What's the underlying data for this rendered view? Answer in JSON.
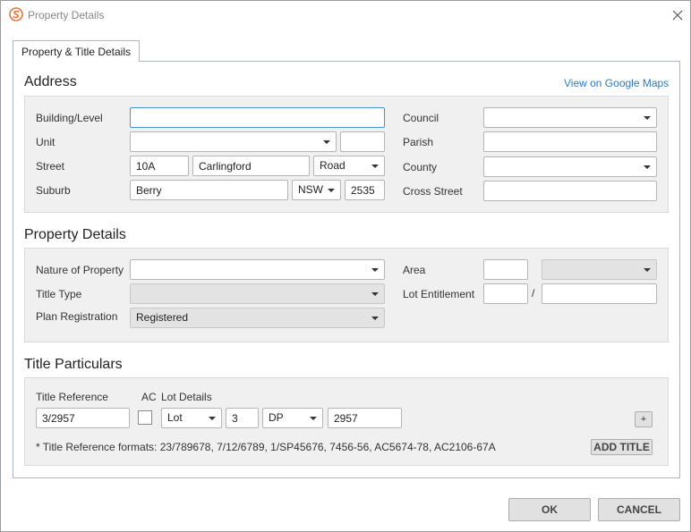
{
  "window": {
    "title": "Property Details"
  },
  "tabs": [
    {
      "label": "Property & Title Details"
    }
  ],
  "address": {
    "section_title": "Address",
    "maps_link": "View on Google Maps",
    "building_level": {
      "label": "Building/Level",
      "value": ""
    },
    "unit": {
      "label": "Unit",
      "type": "",
      "number": ""
    },
    "street": {
      "label": "Street",
      "number": "10A",
      "name": "Carlingford",
      "type": "Road"
    },
    "suburb": {
      "label": "Suburb",
      "name": "Berry",
      "state": "NSW",
      "postcode": "2535"
    },
    "council": {
      "label": "Council",
      "value": ""
    },
    "parish": {
      "label": "Parish",
      "value": ""
    },
    "county": {
      "label": "County",
      "value": ""
    },
    "cross_street": {
      "label": "Cross Street",
      "value": ""
    }
  },
  "property_details": {
    "section_title": "Property Details",
    "nature_of_property": {
      "label": "Nature of Property",
      "value": ""
    },
    "title_type": {
      "label": "Title Type",
      "value": ""
    },
    "plan_registration": {
      "label": "Plan Registration",
      "value": "Registered"
    },
    "area": {
      "label": "Area",
      "value": "",
      "unit": ""
    },
    "lot_entitlement": {
      "label": "Lot Entitlement",
      "numerator": "",
      "separator": "/",
      "denominator": ""
    }
  },
  "title_particulars": {
    "section_title": "Title Particulars",
    "title_reference_label": "Title Reference",
    "ac_label": "AC",
    "lot_details_label": "Lot Details",
    "title_reference": "3/2957",
    "lot_type": "Lot",
    "lot_number": "3",
    "plan_type": "DP",
    "plan_number": "2957",
    "add_row_label": "+",
    "formats_note": "* Title Reference formats: 23/789678, 7/12/6789, 1/SP45676, 7456-56, AC5674-78, AC2106-67A",
    "add_title_label": "ADD TITLE"
  },
  "footer": {
    "ok_label": "OK",
    "cancel_label": "CANCEL"
  },
  "colors": {
    "accent": "#2f7ac4",
    "logo": "#e8743b",
    "panel": "#f0f0f0"
  }
}
